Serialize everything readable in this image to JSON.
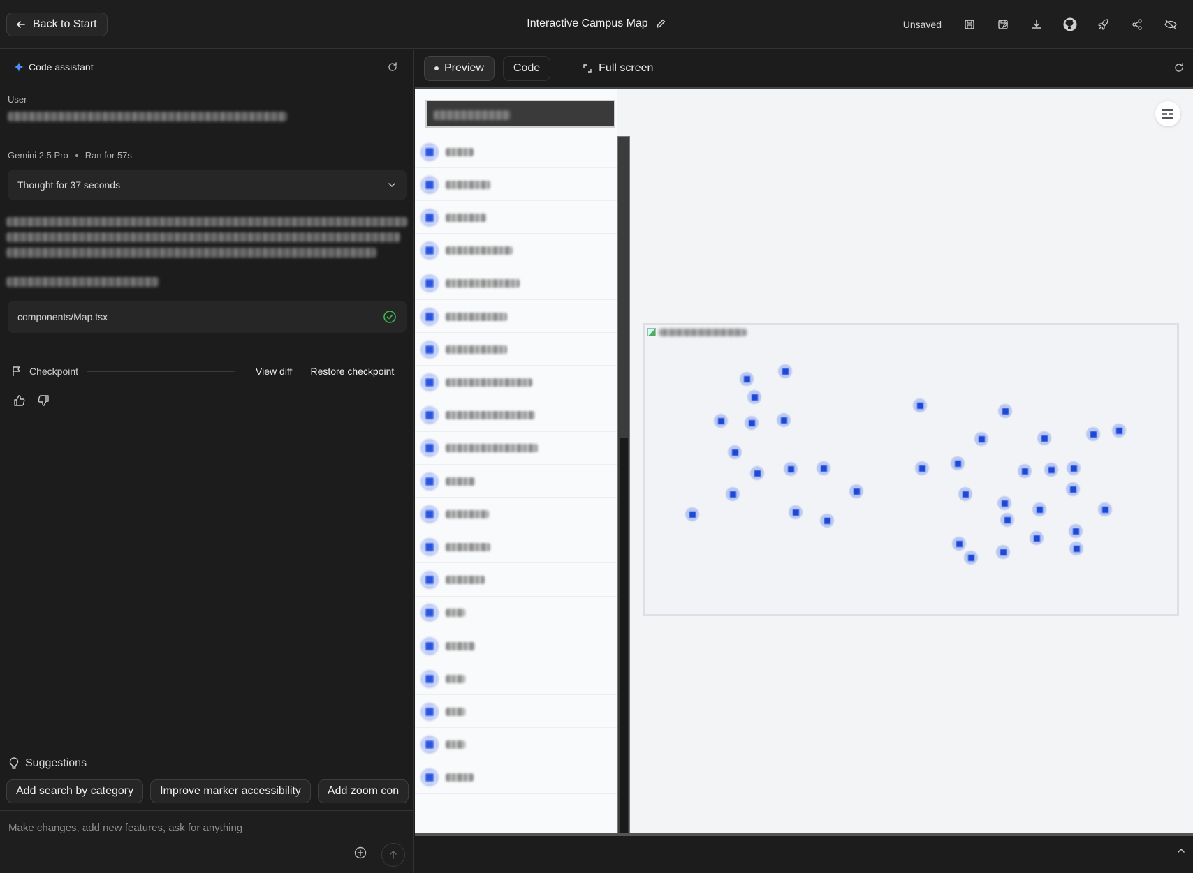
{
  "topbar": {
    "back_label": "Back to Start",
    "title": "Interactive Campus Map",
    "status": "Unsaved",
    "icons": [
      "save-icon",
      "save-as-icon",
      "download-icon",
      "github-icon",
      "deploy-rocket-icon",
      "share-icon",
      "hide-code-icon"
    ]
  },
  "assistant": {
    "title": "Code assistant",
    "user_label": "User",
    "model": "Gemini 2.5 Pro",
    "ran_for": "Ran for 57s",
    "thought": "Thought for 37 seconds",
    "file": "components/Map.tsx",
    "checkpoint_label": "Checkpoint",
    "view_diff": "View diff",
    "restore": "Restore checkpoint"
  },
  "suggestions": {
    "label": "Suggestions",
    "items": [
      "Add search by category",
      "Improve marker accessibility",
      "Add zoom con"
    ]
  },
  "prompt": {
    "placeholder": "Make changes, add new features, ask for anything"
  },
  "preview": {
    "tabs": {
      "preview": "Preview",
      "code": "Code",
      "fullscreen": "Full screen"
    },
    "accent_color": "#2a55e0",
    "list_items": [
      {
        "w": 40
      },
      {
        "w": 64
      },
      {
        "w": 58
      },
      {
        "w": 96
      },
      {
        "w": 106
      },
      {
        "w": 88
      },
      {
        "w": 88
      },
      {
        "w": 124
      },
      {
        "w": 128
      },
      {
        "w": 132
      },
      {
        "w": 42
      },
      {
        "w": 62
      },
      {
        "w": 64
      },
      {
        "w": 56
      },
      {
        "w": 28
      },
      {
        "w": 42
      },
      {
        "w": 28
      },
      {
        "w": 28
      },
      {
        "w": 28
      },
      {
        "w": 40
      }
    ]
  }
}
